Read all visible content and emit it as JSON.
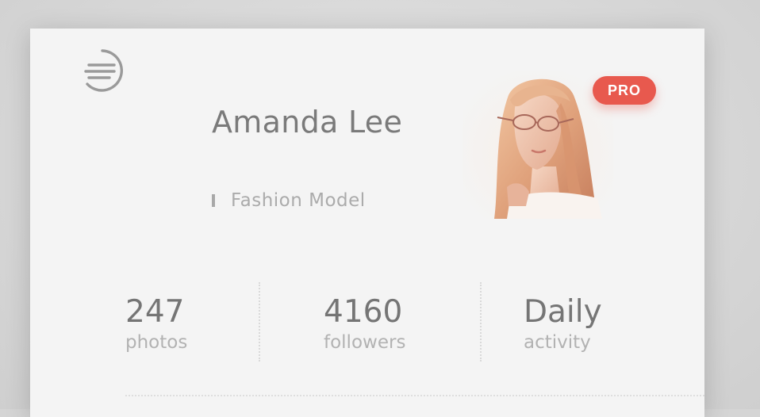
{
  "profile": {
    "name": "Amanda Lee",
    "role": "Fashion Model",
    "badge": "PRO"
  },
  "stats": [
    {
      "value": "247",
      "label": "photos"
    },
    {
      "value": "4160",
      "label": "followers"
    },
    {
      "value": "Daily",
      "label": "activity"
    }
  ],
  "icons": {
    "menu": "menu-lines-icon"
  },
  "colors": {
    "card": "#f4f4f4",
    "badge": "#e8594e",
    "name_text": "#7a7a7a",
    "muted_text": "#b2b2b2",
    "backdrop": "#d5d5d5"
  }
}
